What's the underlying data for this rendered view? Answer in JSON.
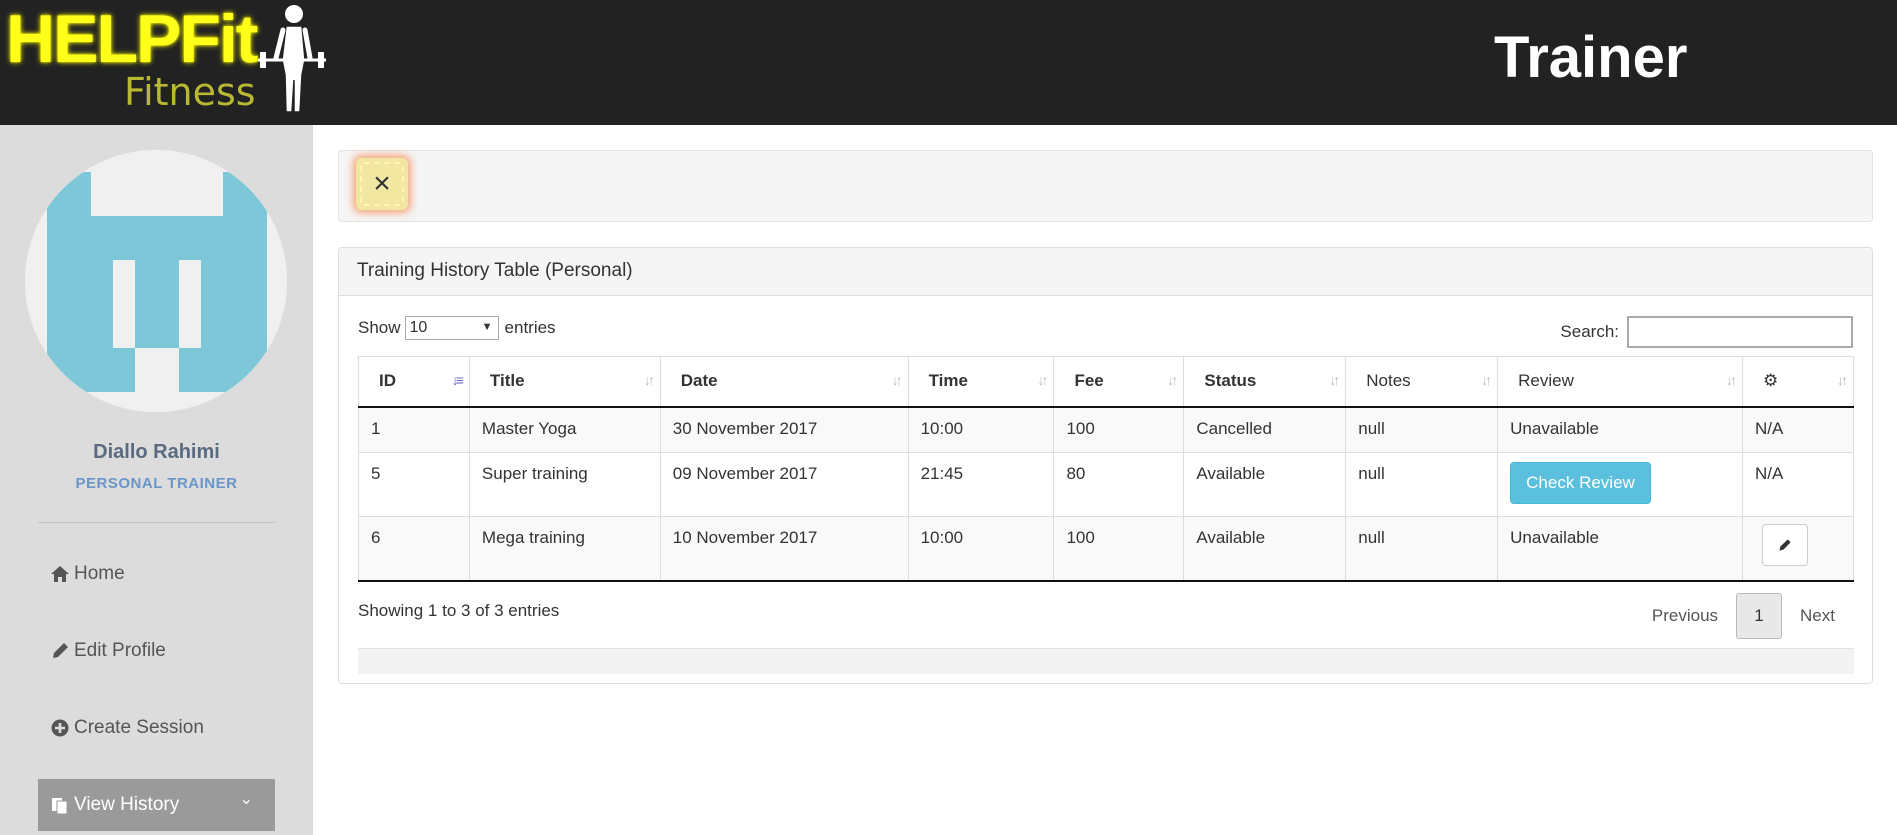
{
  "header": {
    "logo_main": "HELPFit",
    "logo_sub": "Fitness",
    "title": "Trainer"
  },
  "sidebar": {
    "user_name": "Diallo Rahimi",
    "user_role": "PERSONAL TRAINER",
    "items": [
      {
        "label": "Home",
        "icon": "home-icon"
      },
      {
        "label": "Edit Profile",
        "icon": "pencil-icon"
      },
      {
        "label": "Create Session",
        "icon": "plus-circle-icon"
      },
      {
        "label": "View History",
        "icon": "documents-icon",
        "active": true
      }
    ],
    "accent": "#7dc7d9"
  },
  "alert": {
    "close_label": "×"
  },
  "panel": {
    "title": "Training History Table (Personal)",
    "show_label": "Show",
    "entries_value": "10",
    "entries_label": "entries",
    "search_label": "Search:",
    "search_value": ""
  },
  "table": {
    "columns": [
      "ID",
      "Title",
      "Date",
      "Time",
      "Fee",
      "Status",
      "Notes",
      "Review",
      "⚙"
    ],
    "rows": [
      {
        "id": "1",
        "title": "Master Yoga",
        "date": "30 November 2017",
        "time": "10:00",
        "fee": "100",
        "status": "Cancelled",
        "notes": "null",
        "review": "Unavailable",
        "action": "N/A"
      },
      {
        "id": "5",
        "title": "Super training",
        "date": "09 November 2017",
        "time": "21:45",
        "fee": "80",
        "status": "Available",
        "notes": "null",
        "review": "Check Review",
        "action": "N/A"
      },
      {
        "id": "6",
        "title": "Mega training",
        "date": "10 November 2017",
        "time": "10:00",
        "fee": "100",
        "status": "Available",
        "notes": "null",
        "review": "Unavailable",
        "action": "edit"
      }
    ]
  },
  "footer": {
    "info": "Showing 1 to 3 of 3 entries",
    "previous": "Previous",
    "page": "1",
    "next": "Next"
  }
}
